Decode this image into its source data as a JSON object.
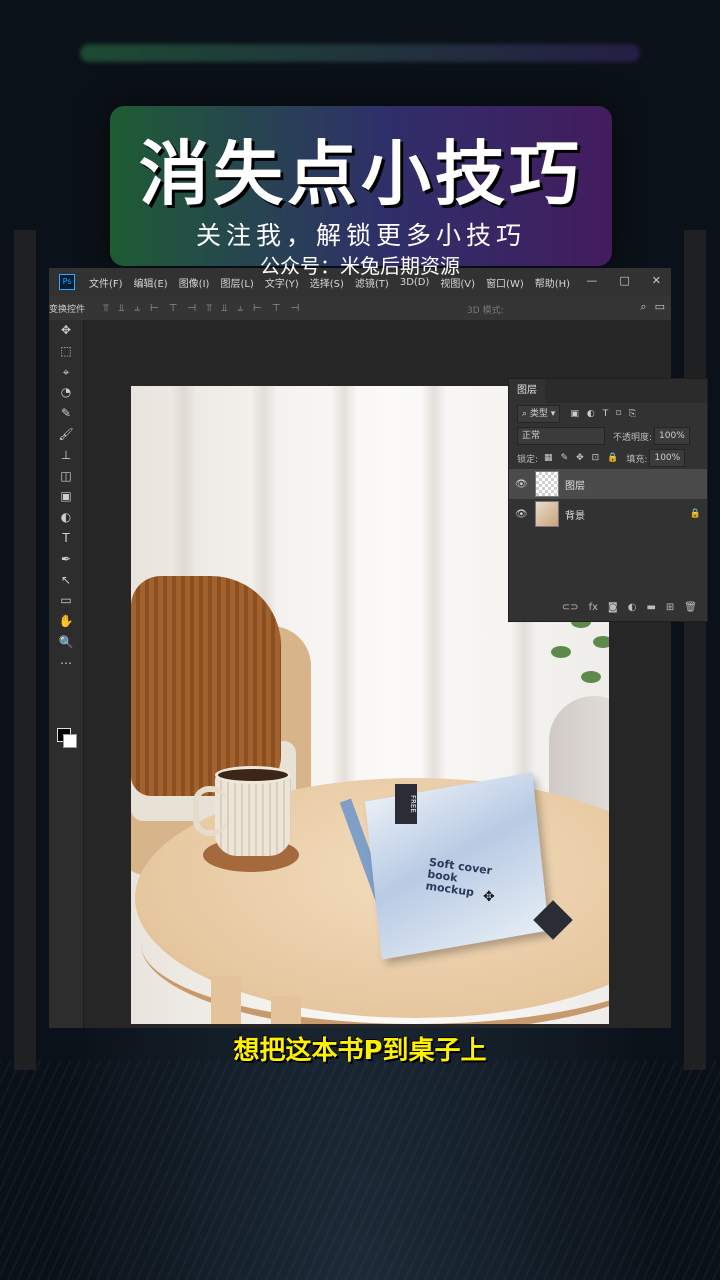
{
  "banner": {
    "title": "消失点小技巧",
    "subtitle": "关注我，解锁更多小技巧"
  },
  "watermark": "公众号：米兔后期资源",
  "photoshop": {
    "menu": [
      "文件(F)",
      "编辑(E)",
      "图像(I)",
      "图层(L)",
      "文字(Y)",
      "选择(S)",
      "滤镜(T)",
      "3D(D)",
      "视图(V)",
      "窗口(W)",
      "帮助(H)"
    ],
    "options_label": "变换控件",
    "mode_3d": "3D 模式:",
    "tools": [
      "move-icon",
      "marquee-icon",
      "lasso-icon",
      "quick-select-icon",
      "eyedropper-icon",
      "brush-icon",
      "stamp-icon",
      "eraser-icon",
      "gradient-icon",
      "dodge-icon",
      "type-icon",
      "pen-icon",
      "path-select-icon",
      "shape-icon",
      "hand-icon",
      "zoom-icon",
      "more-icon"
    ],
    "tool_glyphs": [
      "✥",
      "⬚",
      "⌖",
      "◔",
      "✎",
      "🖌",
      "⊥",
      "◫",
      "▣",
      "◐",
      "T",
      "✒",
      "↖",
      "▭",
      "✋",
      "🔍",
      "⋯"
    ],
    "layers_panel": {
      "tab": "图层",
      "kind_filter": "类型",
      "blend_mode": "正常",
      "opacity_label": "不透明度:",
      "opacity_value": "100%",
      "lock_label": "锁定:",
      "fill_label": "填充:",
      "fill_value": "100%",
      "layers": [
        {
          "name": "图层",
          "selected": true
        },
        {
          "name": "背景",
          "selected": false,
          "locked": true
        }
      ]
    }
  },
  "book": {
    "tag": "FREE",
    "text": "Soft cover book mockup"
  },
  "caption": "想把这本书P到桌子上"
}
